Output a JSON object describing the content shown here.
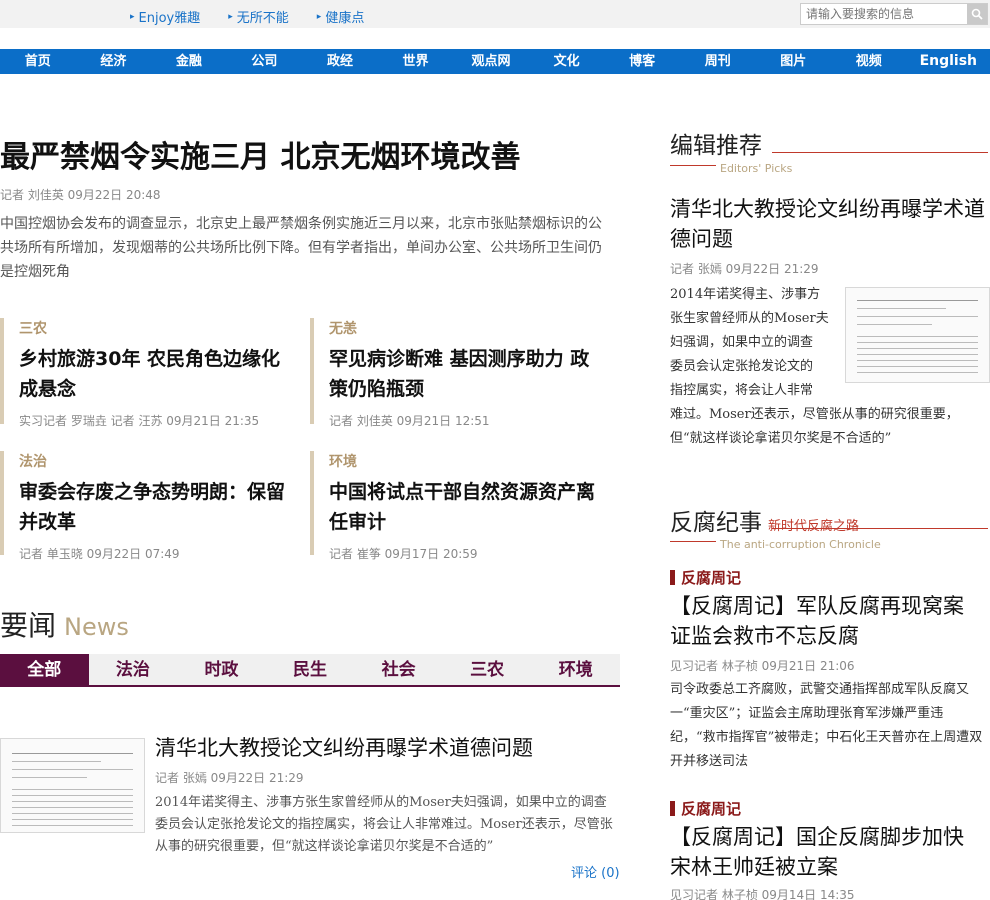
{
  "topbar": {
    "links": [
      "Enjoy雅趣",
      "无所不能",
      "健康点"
    ],
    "search_placeholder": "请输入要搜索的信息"
  },
  "nav": [
    "首页",
    "经济",
    "金融",
    "公司",
    "政经",
    "世界",
    "观点网",
    "文化",
    "博客",
    "周刊",
    "图片",
    "视频",
    "English"
  ],
  "lead": {
    "title": "最严禁烟令实施三月 北京无烟环境改善",
    "byline": "记者  刘佳英  09月22日  20:48",
    "summary": "中国控烟协会发布的调查显示，北京史上最严禁烟条例实施近三月以来，北京市张贴禁烟标识的公共场所有所增加，发现烟蒂的公共场所比例下降。但有学者指出，单间办公室、公共场所卫生间仍是控烟死角"
  },
  "cards": [
    {
      "tag": "三农",
      "title": "乡村旅游30年 农民角色边缘化成悬念",
      "byline": "实习记者  罗瑞垚  记者  汪苏  09月21日  21:35"
    },
    {
      "tag": "无恙",
      "title": "罕见病诊断难 基因测序助力 政策仍陷瓶颈",
      "byline": "记者  刘佳英  09月21日  12:51"
    },
    {
      "tag": "法治",
      "title": "审委会存废之争态势明朗：保留并改革",
      "byline": "记者  单玉晓  09月22日  07:49"
    },
    {
      "tag": "环境",
      "title": "中国将试点干部自然资源资产离任审计",
      "byline": "记者  崔筝  09月17日  20:59"
    }
  ],
  "news": {
    "heading_cn": "要闻",
    "heading_en": "News",
    "tabs": [
      "全部",
      "法治",
      "时政",
      "民生",
      "社会",
      "三农",
      "环境"
    ],
    "item": {
      "title": "清华北大教授论文纠纷再曝学术道德问题",
      "byline": "记者  张嫣  09月22日  21:29",
      "summary": "2014年诺奖得主、涉事方张生家曾经师从的Moser夫妇强调，如果中立的调查委员会认定张抢发论文的指控属实，将会让人非常难过。Moser还表示，尽管张从事的研究很重要，但“就这样谈论拿诺贝尔奖是不合适的”",
      "comment": "评论 (0)"
    }
  },
  "editors": {
    "heading": "编辑推荐",
    "heading_en": "Editors' Picks",
    "title": "清华北大教授论文纠纷再曝学术道德问题",
    "byline": "记者  张嫣  09月22日  21:29",
    "summary_lines": [
      "2014年诺奖得主、涉事方",
      "张生家曾经师从的Moser夫",
      "妇强调，如果中立的调查",
      "委员会认定张抢发论文的",
      "指控属实，将会让人非常"
    ],
    "summary_tail": "难过。Moser还表示，尽管张从事的研究很重要，但“就这样谈论拿诺贝尔奖是不合适的”"
  },
  "anticorruption": {
    "heading": "反腐纪事",
    "sub": "新时代反腐之路",
    "heading_en": "The anti-corruption Chronicle",
    "items": [
      {
        "tag": "反腐周记",
        "title": "【反腐周记】军队反腐再现窝案 证监会救市不忘反腐",
        "byline": "见习记者  林子桢  09月21日  21:06",
        "summary": "司令政委总工齐腐败，武警交通指挥部成军队反腐又一“重灾区”；证监会主席助理张育军涉嫌严重违纪，“救市指挥官”被带走；中石化王天普亦在上周遭双开并移送司法"
      },
      {
        "tag": "反腐周记",
        "title": "【反腐周记】国企反腐脚步加快 宋林王帅廷被立案",
        "byline": "见习记者  林子桢  09月14日  14:35"
      }
    ]
  },
  "colors": {
    "nav_blue": "#0b6ec8",
    "tab_purple": "#5b0f3f",
    "accent_red": "#c0392b",
    "tag_gold": "#b0956d"
  }
}
